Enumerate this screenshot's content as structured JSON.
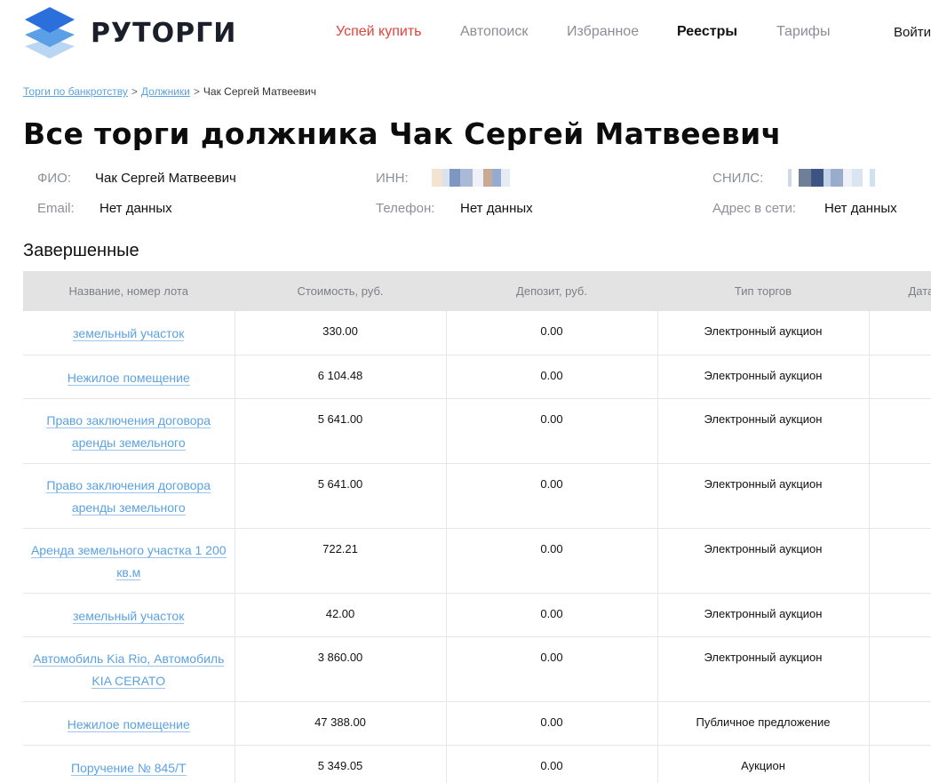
{
  "brand": {
    "name": "РУТОРГИ"
  },
  "nav": [
    {
      "label": "Успей купить",
      "type": "accent"
    },
    {
      "label": "Автопоиск",
      "type": "normal"
    },
    {
      "label": "Избранное",
      "type": "normal"
    },
    {
      "label": "Реестры",
      "type": "active"
    },
    {
      "label": "Тарифы",
      "type": "normal"
    }
  ],
  "login_label": "Войти",
  "breadcrumb": {
    "items": [
      "Торги по банкротству",
      "Должники"
    ],
    "current": "Чак Сергей Матвеевич",
    "separator": ">"
  },
  "title": "Все торги должника Чак Сергей Матвеевич",
  "info": {
    "fio_label": "ФИО:",
    "fio_value": "Чак Сергей Матвеевич",
    "inn_label": "ИНН:",
    "snils_label": "СНИЛС:",
    "email_label": "Email:",
    "email_value": "Нет данных",
    "phone_label": "Телефон:",
    "phone_value": "Нет данных",
    "web_label": "Адрес в сети:",
    "web_value": "Нет данных"
  },
  "section_title": "Завершенные",
  "table": {
    "headers": [
      "Название, номер лота",
      "Стоимость, руб.",
      "Депозит, руб.",
      "Тип торгов",
      "Дата"
    ],
    "rows": [
      {
        "name": "земельный участок",
        "cost": "330.00",
        "deposit": "0.00",
        "type": "Электронный аукцион"
      },
      {
        "name": "Нежилое помещение",
        "cost": "6 104.48",
        "deposit": "0.00",
        "type": "Электронный аукцион"
      },
      {
        "name": "Право заключения договора аренды земельного",
        "cost": "5 641.00",
        "deposit": "0.00",
        "type": "Электронный аукцион"
      },
      {
        "name": "Право заключения договора аренды земельного",
        "cost": "5 641.00",
        "deposit": "0.00",
        "type": "Электронный аукцион"
      },
      {
        "name": "Аренда земельного участка 1 200 кв.м",
        "cost": "722.21",
        "deposit": "0.00",
        "type": "Электронный аукцион"
      },
      {
        "name": "земельный участок",
        "cost": "42.00",
        "deposit": "0.00",
        "type": "Электронный аукцион"
      },
      {
        "name": "Автомобиль Kia Rio, Автомобиль KIA CERATO",
        "cost": "3 860.00",
        "deposit": "0.00",
        "type": "Электронный аукцион"
      },
      {
        "name": "Нежилое помещение",
        "cost": "47 388.00",
        "deposit": "0.00",
        "type": "Публичное предложение"
      },
      {
        "name": "Поручение № 845/Т",
        "cost": "5 349.05",
        "deposit": "0.00",
        "type": "Аукцион"
      }
    ]
  }
}
